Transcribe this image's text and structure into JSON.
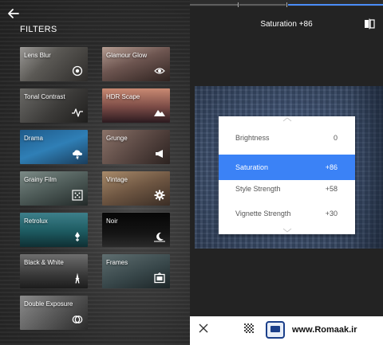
{
  "left_panel": {
    "title": "FILTERS",
    "filters": [
      {
        "label": "Lens Blur",
        "icon": "lens-blur-icon"
      },
      {
        "label": "Glamour Glow",
        "icon": "eye-icon"
      },
      {
        "label": "Tonal Contrast",
        "icon": "pulse-icon"
      },
      {
        "label": "HDR Scape",
        "icon": "mountain-icon"
      },
      {
        "label": "Drama",
        "icon": "cloud-bolt-icon"
      },
      {
        "label": "Grunge",
        "icon": "megaphone-icon"
      },
      {
        "label": "Grainy Film",
        "icon": "grain-icon"
      },
      {
        "label": "Vintage",
        "icon": "gear-icon"
      },
      {
        "label": "Retrolux",
        "icon": "spark-icon"
      },
      {
        "label": "Noir",
        "icon": "moon-icon"
      },
      {
        "label": "Black & White",
        "icon": "tower-icon"
      },
      {
        "label": "Frames",
        "icon": "frame-icon"
      },
      {
        "label": "Double Exposure",
        "icon": "overlap-icon"
      }
    ]
  },
  "right_panel": {
    "title": "Saturation +86",
    "adjustments": [
      {
        "label": "Brightness",
        "value": "0"
      },
      {
        "label": "Saturation",
        "value": "+86",
        "active": true
      },
      {
        "label": "Style Strength",
        "value": "+58"
      },
      {
        "label": "Vignette Strength",
        "value": "+30"
      }
    ]
  },
  "bottom_bar": {
    "watermark": "www.Romaak.ir"
  },
  "colors": {
    "accent": "#3b82f6",
    "panel_dark": "#232323"
  }
}
